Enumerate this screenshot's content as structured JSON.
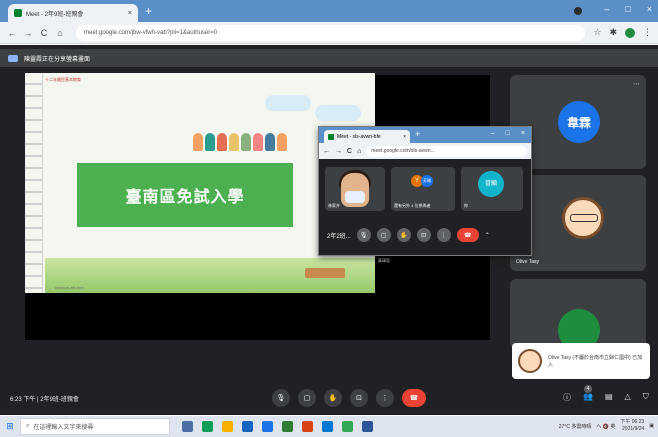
{
  "browser": {
    "tab_title": "Meet - 2年9班-班親會",
    "tab_close": "×",
    "new_tab": "+",
    "nav_back": "←",
    "nav_forward": "→",
    "nav_reload": "C",
    "nav_home": "⌂",
    "url": "meet.google.com/jbw-vfwh-vab?pli=1&authuser=0",
    "win_min": "–",
    "win_max": "□",
    "win_close": "×",
    "star": "☆",
    "ext": "✱",
    "menu": "⋮"
  },
  "banner": {
    "text": "陳靈霞正在分享螢幕畫面"
  },
  "slide": {
    "header": "十二年國民基本教育",
    "title": "臺南區免試入學",
    "footer": "www.pa-art.com"
  },
  "pip": {
    "tab_title": "Meet - sls-avwn-bfe",
    "tab_close": "×",
    "new_tab": "+",
    "win_controls": [
      "–",
      "□",
      "×"
    ],
    "url": "meet.google.com/sls-avwn...",
    "nav": [
      "←",
      "→",
      "C",
      "⌂"
    ],
    "self_name": "林家卉",
    "others_caption": "還有另外 4 位參與者",
    "others_initial_a": "Y",
    "others_initial_b": "芳瑜",
    "third_initials": "晉願",
    "third_caption": "你",
    "meeting_code": "2年2班...",
    "outside_caption": "黃瑋容"
  },
  "tiles": [
    {
      "initials": "韋霖",
      "color": "#1a73e8"
    },
    {
      "name": "Olive Tasy"
    },
    {
      "initials": "",
      "color": "#1e8e3e"
    }
  ],
  "toast": {
    "text": "Olive Tasy (不屬於台南市立歸仁國中) 已加入"
  },
  "bottom": {
    "meeting_info": "6:23 下午 | 2年9班-班親會",
    "participant_count": "4"
  },
  "taskbar": {
    "search_placeholder": "在這裡輸入文字來搜尋",
    "weather": "27°C 多雲時晴",
    "ime": "へ 🔇 英",
    "time": "下午 06:23",
    "date": "2021/9/24"
  }
}
